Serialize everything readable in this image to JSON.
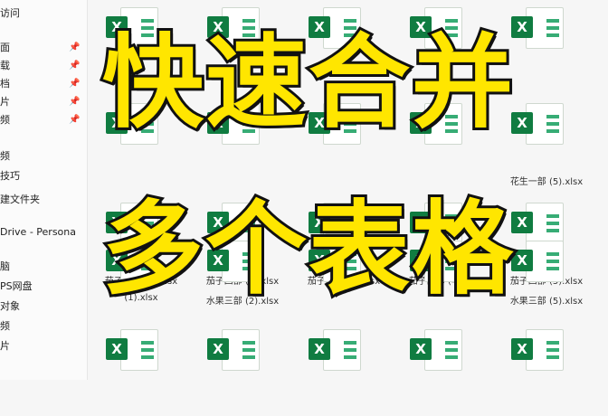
{
  "sidebar": {
    "items": [
      {
        "label": "访问",
        "pinned": false
      },
      {
        "label": "面",
        "pinned": true
      },
      {
        "label": "载",
        "pinned": true
      },
      {
        "label": "档",
        "pinned": true
      },
      {
        "label": "片",
        "pinned": true
      },
      {
        "label": "频",
        "pinned": true
      },
      {
        "label": "频",
        "pinned": false
      },
      {
        "label": "技巧",
        "pinned": false
      },
      {
        "label": "建文件夹",
        "pinned": false
      },
      {
        "label": "Drive - Persona",
        "pinned": false
      },
      {
        "label": "脑",
        "pinned": false
      },
      {
        "label": "PS网盘",
        "pinned": false
      },
      {
        "label": "对象",
        "pinned": false
      },
      {
        "label": "频",
        "pinned": false
      },
      {
        "label": "片",
        "pinned": false
      }
    ]
  },
  "files": {
    "row1": [
      "",
      "",
      "",
      "",
      ""
    ],
    "row2": [
      "",
      "",
      "",
      "",
      "花生一部 (5).xlsx"
    ],
    "row3": [
      "茄子四部 (1).xlsx",
      "茄子四部 (2).xlsx",
      "茄子四部 (3).xlsx",
      "茄子四部 (4).xlsx",
      "茄子四部 (5).xlsx"
    ],
    "row4": [
      "(1).xlsx",
      "水果三部 (2).xlsx",
      "",
      "",
      "水果三部 (5).xlsx"
    ],
    "row5": [
      "",
      "",
      "",
      "",
      ""
    ]
  },
  "overlay": {
    "line1": "快速合并",
    "line2": "多个表格"
  },
  "colors": {
    "excel_green": "#107c41",
    "headline_yellow": "#ffe600",
    "headline_stroke": "#111111"
  }
}
